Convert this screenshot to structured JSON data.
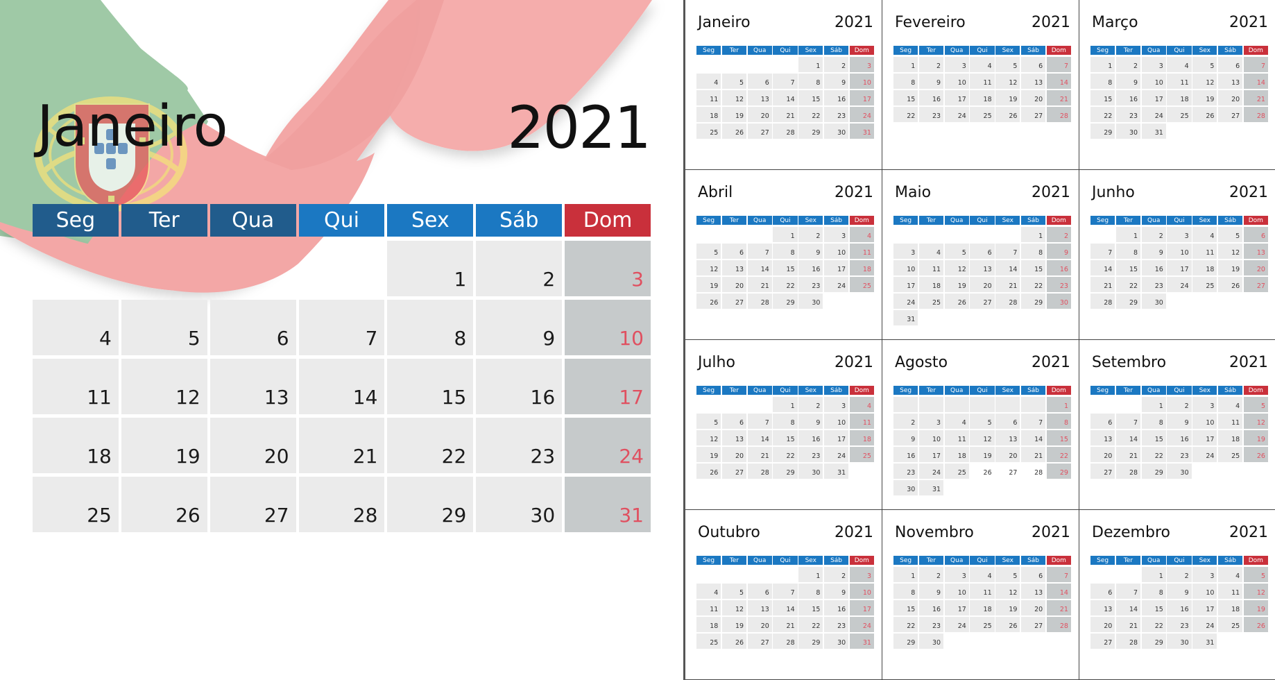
{
  "colors": {
    "header_blue": "#1b78c2",
    "header_blue_under_flag": "#215c8c",
    "header_red": "#c9303b",
    "weekday_cell": "#ebebeb",
    "sunday_cell": "#c6cacb",
    "sunday_number": "#e05060",
    "flag_green": "#9fc9a6",
    "flag_red": "#f3a7a6"
  },
  "weekdays": [
    "Seg",
    "Ter",
    "Qua",
    "Qui",
    "Sex",
    "Sáb",
    "Dom"
  ],
  "featured": {
    "month": "Janeiro",
    "year": "2021",
    "weeks": [
      [
        "",
        "",
        "",
        "",
        "1",
        "2",
        "3"
      ],
      [
        "4",
        "5",
        "6",
        "7",
        "8",
        "9",
        "10"
      ],
      [
        "11",
        "12",
        "13",
        "14",
        "15",
        "16",
        "17"
      ],
      [
        "18",
        "19",
        "20",
        "21",
        "22",
        "23",
        "24"
      ],
      [
        "25",
        "26",
        "27",
        "28",
        "29",
        "30",
        "31"
      ]
    ]
  },
  "months": [
    {
      "name": "Janeiro",
      "year": "2021",
      "first_weekday": 4,
      "days": 31
    },
    {
      "name": "Fevereiro",
      "year": "2021",
      "first_weekday": 0,
      "days": 28
    },
    {
      "name": "Março",
      "year": "2021",
      "first_weekday": 0,
      "days": 31
    },
    {
      "name": "Abril",
      "year": "2021",
      "first_weekday": 3,
      "days": 30
    },
    {
      "name": "Maio",
      "year": "2021",
      "first_weekday": 5,
      "days": 31
    },
    {
      "name": "Junho",
      "year": "2021",
      "first_weekday": 1,
      "days": 30
    },
    {
      "name": "Julho",
      "year": "2021",
      "first_weekday": 3,
      "days": 31
    },
    {
      "name": "Agosto",
      "year": "2021",
      "first_weekday": 6,
      "days": 31,
      "grey_leading_blanks": true,
      "no_background_days": [
        26,
        27,
        28
      ]
    },
    {
      "name": "Setembro",
      "year": "2021",
      "first_weekday": 2,
      "days": 30
    },
    {
      "name": "Outubro",
      "year": "2021",
      "first_weekday": 4,
      "days": 31
    },
    {
      "name": "Novembro",
      "year": "2021",
      "first_weekday": 0,
      "days": 30
    },
    {
      "name": "Dezembro",
      "year": "2021",
      "first_weekday": 2,
      "days": 31
    }
  ]
}
